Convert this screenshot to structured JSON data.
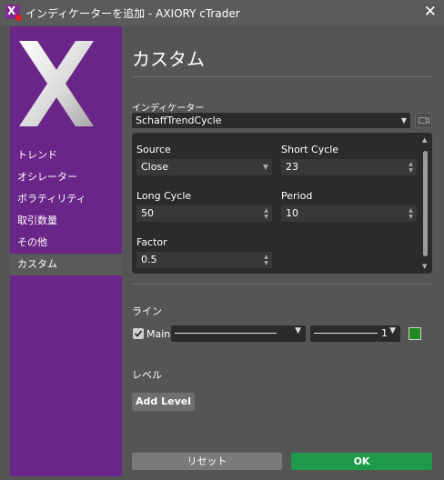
{
  "window": {
    "title": "インディケーターを追加 - AXIORY cTrader"
  },
  "sidebar": {
    "items": [
      {
        "label": "トレンド"
      },
      {
        "label": "オシレーター"
      },
      {
        "label": "ボラティリティ"
      },
      {
        "label": "取引数量"
      },
      {
        "label": "その他"
      },
      {
        "label": "カスタム",
        "active": true
      }
    ]
  },
  "main": {
    "title": "カスタム",
    "indicator_label": "インディケーター",
    "indicator_value": "SchaffTrendCycle",
    "params": {
      "source": {
        "label": "Source",
        "value": "Close"
      },
      "short_cycle": {
        "label": "Short Cycle",
        "value": "23"
      },
      "long_cycle": {
        "label": "Long Cycle",
        "value": "50"
      },
      "period": {
        "label": "Period",
        "value": "10"
      },
      "factor": {
        "label": "Factor",
        "value": "0.5"
      }
    },
    "lines": {
      "title": "ライン",
      "main_label": "Main",
      "main_checked": true,
      "thickness": "1",
      "color": "#1f8a1f"
    },
    "levels": {
      "title": "レベル",
      "add_label": "Add Level"
    }
  },
  "footer": {
    "reset_label": "リセット",
    "ok_label": "OK"
  },
  "colors": {
    "accent_sidebar": "#6a2588",
    "ok_green": "#1f9a4a"
  }
}
